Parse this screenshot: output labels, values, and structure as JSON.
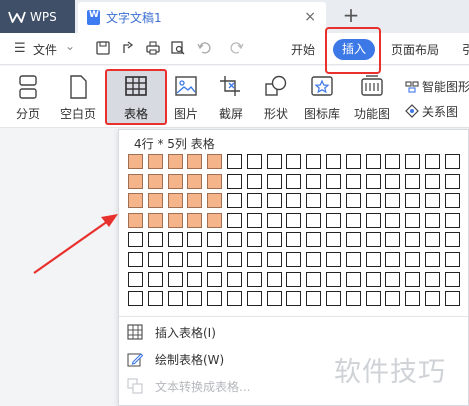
{
  "titlebar": {
    "app_tab": "WPS",
    "doc_tab": "文字文稿1",
    "doc_close": "×",
    "new_tab": "+"
  },
  "menubar": {
    "file_label": "文件",
    "caret": "⌄",
    "items": [
      "开始",
      "插入",
      "页面布局",
      "引"
    ]
  },
  "ribbon": {
    "buttons": [
      {
        "label": "分页",
        "icon": "page-break-icon"
      },
      {
        "label": "空白页",
        "icon": "blank-page-icon"
      },
      {
        "label": "表格",
        "icon": "table-icon"
      },
      {
        "label": "图片",
        "icon": "picture-icon"
      },
      {
        "label": "截屏",
        "icon": "screenshot-icon"
      },
      {
        "label": "形状",
        "icon": "shapes-icon"
      },
      {
        "label": "图标库",
        "icon": "icon-library-icon"
      },
      {
        "label": "功能图",
        "icon": "function-chart-icon"
      }
    ],
    "side_items": [
      {
        "label": "智能图形",
        "icon": "smart-graphic-icon"
      },
      {
        "label": "关系图",
        "icon": "relation-chart-icon"
      }
    ]
  },
  "table_dropdown": {
    "size_label": "4行 * 5列 表格",
    "grid_rows": 8,
    "grid_cols": 17,
    "selected_rows": 4,
    "selected_cols": 5,
    "menu": [
      {
        "label": "插入表格(I)",
        "icon": "insert-table-icon",
        "enabled": true
      },
      {
        "label": "绘制表格(W)",
        "icon": "draw-table-icon",
        "enabled": true
      },
      {
        "label": "文本转换成表格...",
        "icon": "text-to-table-icon",
        "enabled": false
      }
    ]
  },
  "watermark": "软件技巧",
  "colors": {
    "accent": "#3c78e6",
    "highlight": "#e8302d",
    "selected_cell": "#f6b48a",
    "app_tab_bg": "#3f4f67"
  }
}
